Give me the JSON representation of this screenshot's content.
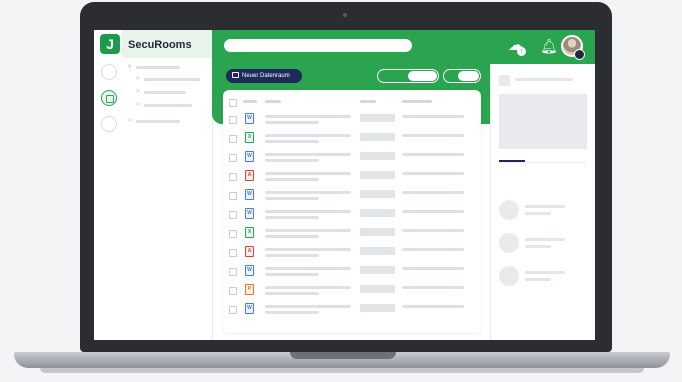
{
  "app": {
    "name": "SecuRooms",
    "logo_glyph": "J"
  },
  "toolbar": {
    "new_room_label": "Neuer Datenraum"
  },
  "icons": {
    "logo": "securooms-logo-icon",
    "cloud_upload": "cloud-upload-icon",
    "notification": "bell-icon",
    "rail": [
      "rail-circle-icon",
      "dataroom-icon",
      "rail-circle-icon"
    ]
  },
  "files": [
    {
      "type": "word",
      "glyph": "W"
    },
    {
      "type": "excel",
      "glyph": "X"
    },
    {
      "type": "word",
      "glyph": "W"
    },
    {
      "type": "pdf",
      "glyph": "A"
    },
    {
      "type": "word",
      "glyph": "W"
    },
    {
      "type": "word",
      "glyph": "W"
    },
    {
      "type": "excel",
      "glyph": "X"
    },
    {
      "type": "pdf",
      "glyph": "A"
    },
    {
      "type": "word",
      "glyph": "W"
    },
    {
      "type": "ppt",
      "glyph": "P"
    },
    {
      "type": "word",
      "glyph": "W"
    }
  ],
  "colors": {
    "brand_green": "#2aa44e",
    "navy": "#1d2a5a",
    "laptop_frame": "#2b2d31"
  }
}
